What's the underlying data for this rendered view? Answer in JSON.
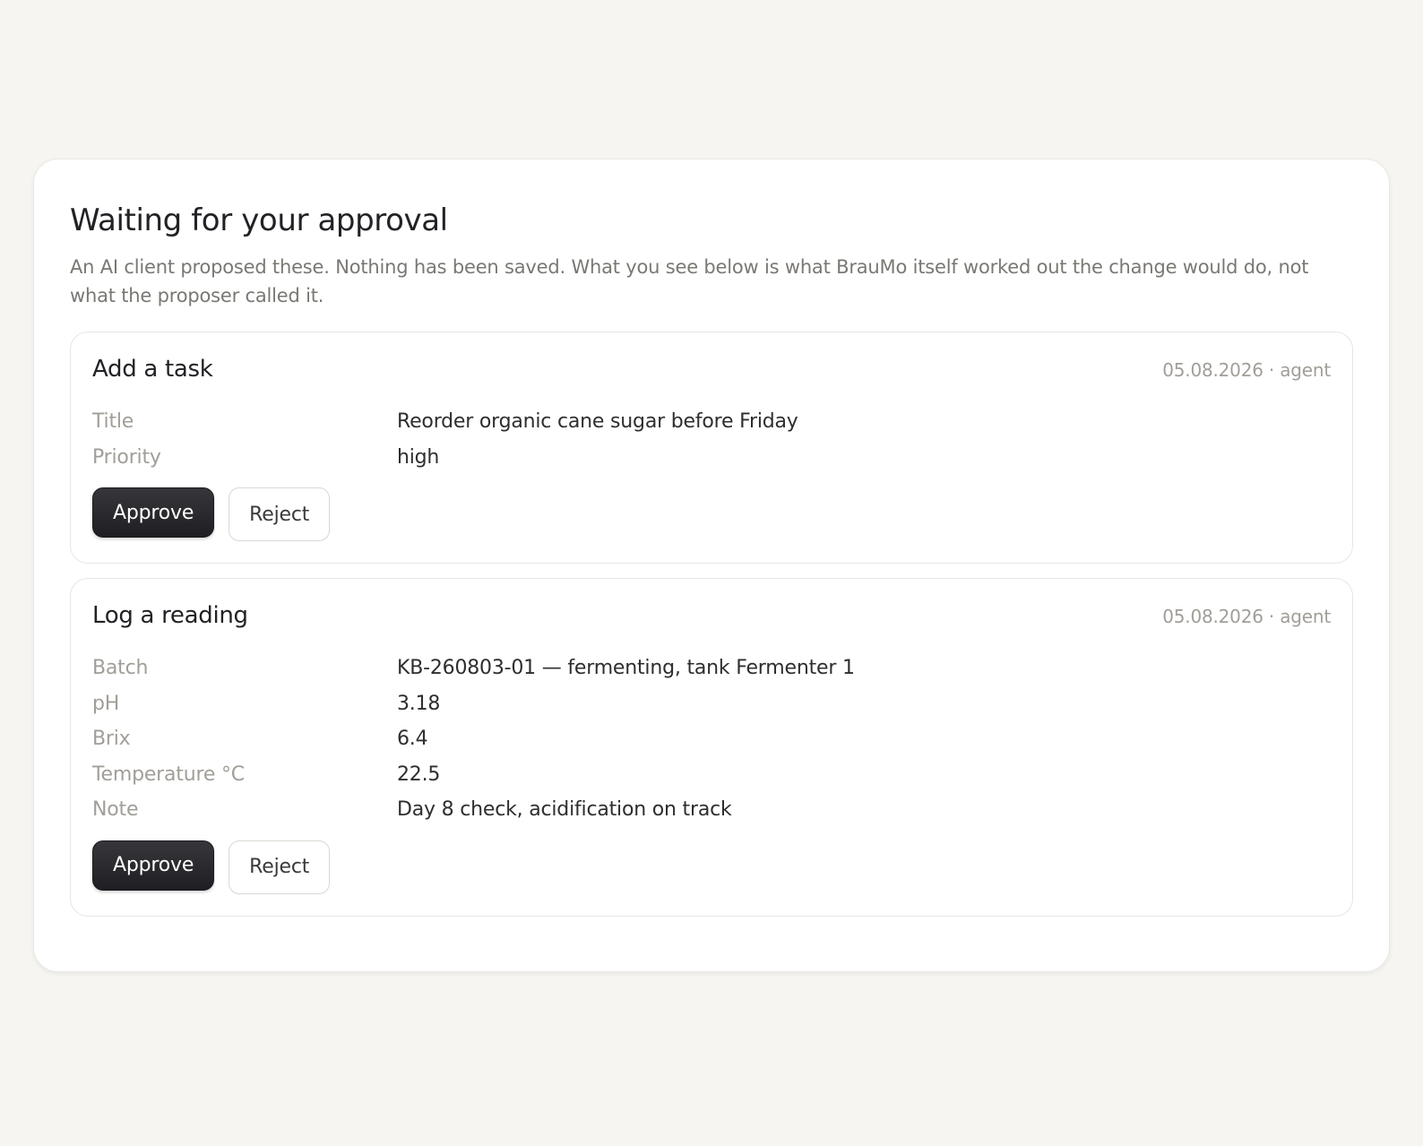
{
  "approvals": {
    "title": "Waiting for your approval",
    "subtitle": "An AI client proposed these. Nothing has been saved. What you see below is what BrauMo itself worked out the change would do, not what the proposer called it.",
    "approve_label": "Approve",
    "reject_label": "Reject",
    "cards": [
      {
        "title": "Add a task",
        "meta": "05.08.2026 · agent",
        "fields": [
          {
            "label": "Title",
            "value": "Reorder organic cane sugar before Friday"
          },
          {
            "label": "Priority",
            "value": "high"
          }
        ]
      },
      {
        "title": "Log a reading",
        "meta": "05.08.2026 · agent",
        "fields": [
          {
            "label": "Batch",
            "value": "KB-260803-01 — fermenting, tank Fermenter 1"
          },
          {
            "label": "pH",
            "value": "3.18"
          },
          {
            "label": "Brix",
            "value": "6.4"
          },
          {
            "label": "Temperature °C",
            "value": "22.5"
          },
          {
            "label": "Note",
            "value": "Day 8 check, acidification on track"
          }
        ]
      }
    ]
  }
}
